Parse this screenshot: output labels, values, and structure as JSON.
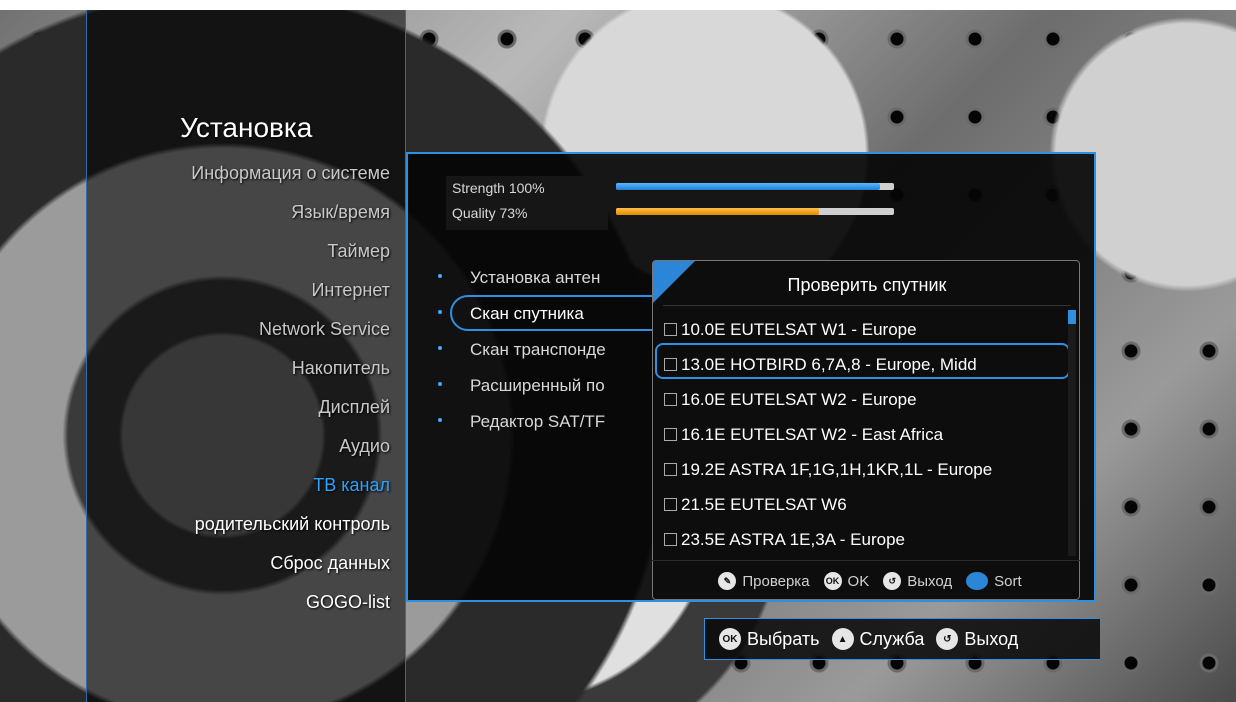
{
  "menu": {
    "title": "Установка",
    "items": [
      {
        "label": "Информация о системе"
      },
      {
        "label": "Язык/время"
      },
      {
        "label": "Таймер"
      },
      {
        "label": "Интернет"
      },
      {
        "label": "Network Service"
      },
      {
        "label": "Накопитель"
      },
      {
        "label": "Дисплей"
      },
      {
        "label": "Аудио"
      },
      {
        "label": "ТВ канал"
      },
      {
        "label": "родительский контроль"
      },
      {
        "label": "Сброс данных"
      },
      {
        "label": "GOGO-list"
      }
    ],
    "active_index": 8
  },
  "signal": {
    "strength_label": "Strength 100%",
    "strength_value": 100,
    "quality_label": "Quality 73%",
    "quality_value": 73
  },
  "scan_menu": {
    "items": [
      {
        "label": "Установка антен"
      },
      {
        "label": "Скан спутника"
      },
      {
        "label": "Скан транспонде"
      },
      {
        "label": "Расширенный по"
      },
      {
        "label": "Редактор SAT/TF"
      }
    ],
    "selected_index": 1
  },
  "popup": {
    "title": "Проверить спутник",
    "satellites": [
      {
        "label": "10.0E EUTELSAT W1 - Europe"
      },
      {
        "label": "13.0E HOTBIRD 6,7A,8 - Europe, Midd"
      },
      {
        "label": "16.0E EUTELSAT W2 - Europe"
      },
      {
        "label": "16.1E EUTELSAT W2 - East Africa"
      },
      {
        "label": "19.2E ASTRA 1F,1G,1H,1KR,1L - Europe"
      },
      {
        "label": "21.5E EUTELSAT W6"
      },
      {
        "label": "23.5E ASTRA 1E,3A - Europe"
      }
    ],
    "selected_index": 1,
    "footer": {
      "check_label": "Проверка",
      "ok_label": "OK",
      "exit_label": "Выход",
      "sort_label": "Sort"
    }
  },
  "bottom_bar": {
    "select_label": "Выбрать",
    "service_label": "Служба",
    "exit_label": "Выход",
    "ok_icon_text": "OK"
  },
  "colors": {
    "accent": "#2f8fe0",
    "active_text": "#2aa3ff",
    "strength_bar": "#1e7fd6",
    "quality_bar": "#e58a00"
  }
}
